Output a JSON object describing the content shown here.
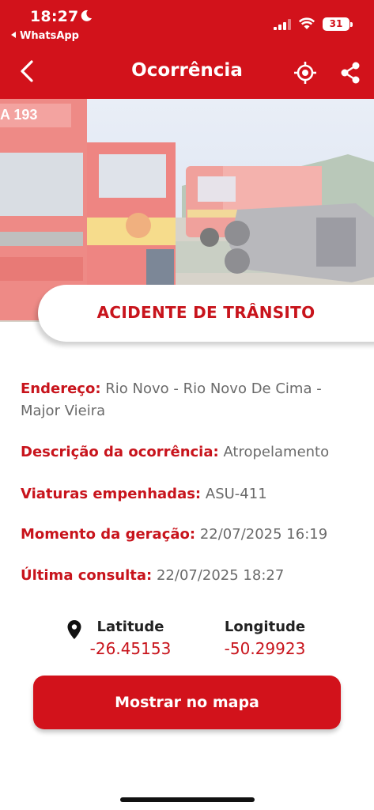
{
  "status_bar": {
    "time": "18:27",
    "back_app": "WhatsApp",
    "battery": "31"
  },
  "header": {
    "title": "Ocorrência"
  },
  "occurrence": {
    "type": "ACIDENTE DE TRÂNSITO",
    "fields": [
      {
        "label": "Endereço:",
        "value": "Rio Novo - Rio Novo De Cima - Major Vieira"
      },
      {
        "label": "Descrição da ocorrência:",
        "value": "Atropelamento"
      },
      {
        "label": "Viaturas empenhadas:",
        "value": "ASU-411"
      },
      {
        "label": "Momento da geração:",
        "value": "22/07/2025 16:19"
      },
      {
        "label": "Última consulta:",
        "value": "22/07/2025 18:27"
      }
    ]
  },
  "coordinates": {
    "latitude_label": "Latitude",
    "latitude": "-26.45153",
    "longitude_label": "Longitude",
    "longitude": "-50.29923"
  },
  "actions": {
    "map_button": "Mostrar no mapa"
  },
  "colors": {
    "brand_red": "#d2121b",
    "label_red": "#c8141c",
    "value_gray": "#6a6a6a"
  },
  "hero_image": {
    "truck_lettering": "A 193"
  }
}
